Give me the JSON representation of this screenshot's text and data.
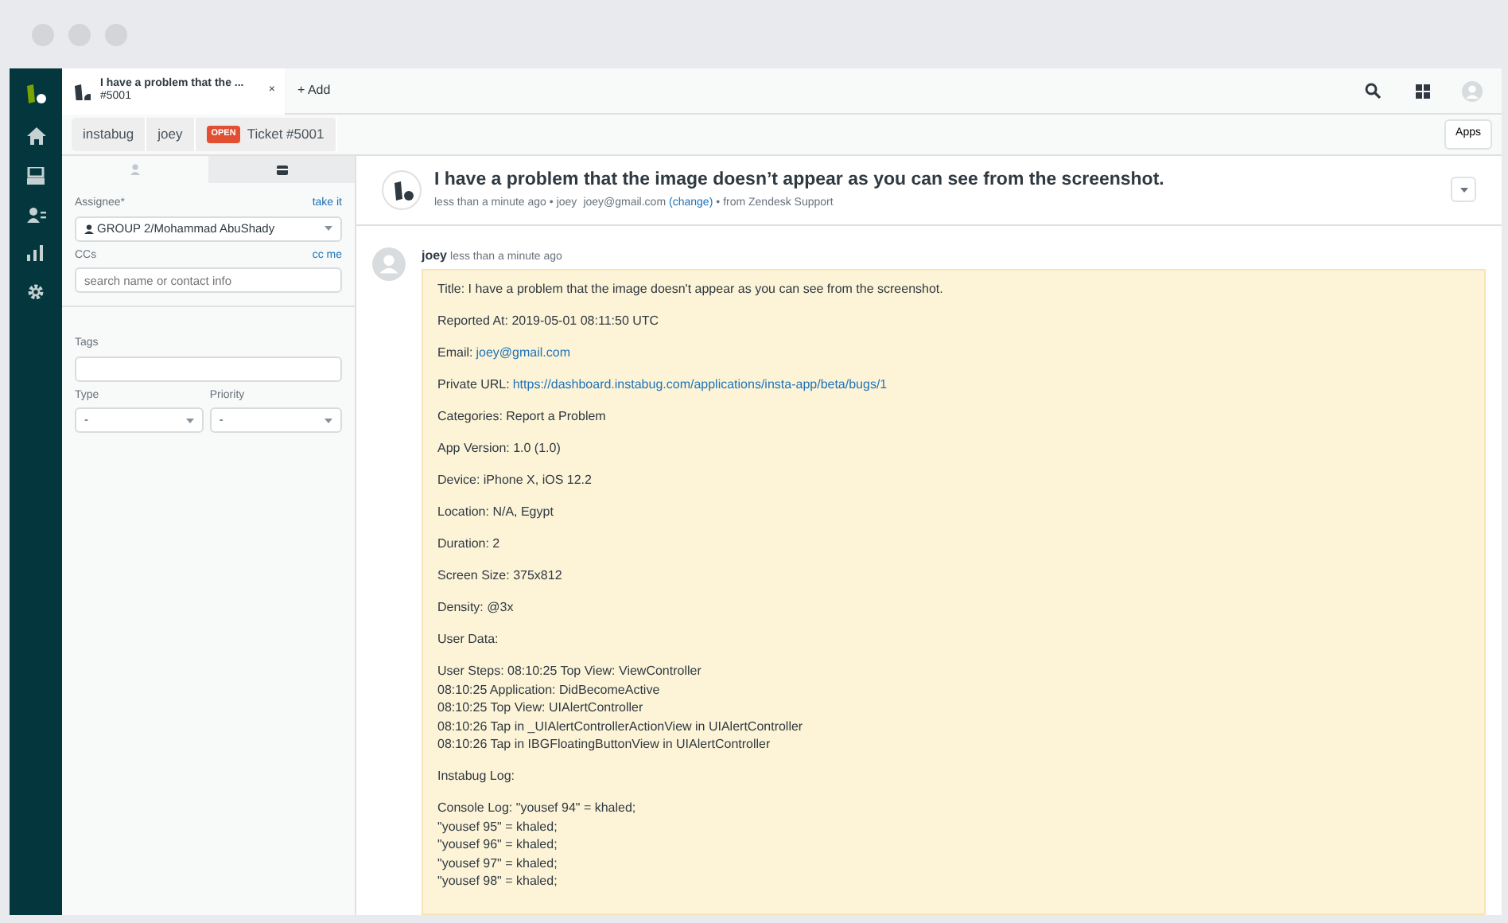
{
  "tab": {
    "title": "I have a problem that the ...",
    "subtitle": "#5001",
    "close": "×"
  },
  "add": "+ Add",
  "breadcrumbs": [
    {
      "kind": "crumb",
      "label": "instabug"
    },
    {
      "kind": "crumb",
      "label": "joey"
    },
    {
      "kind": "ticket",
      "badge": "OPEN",
      "label": "Ticket #5001"
    }
  ],
  "apps_button": "Apps",
  "side_tabs": [
    {
      "kind": "person",
      "selected": true
    },
    {
      "kind": "card",
      "selected": false
    }
  ],
  "assignee": {
    "label": "Assignee*",
    "action": "take it",
    "value": "GROUP 2/Mohammad AbuShady"
  },
  "ccs": {
    "label": "CCs",
    "action": "cc me",
    "placeholder": "search name or contact info"
  },
  "tags": {
    "label": "Tags"
  },
  "type": {
    "label": "Type",
    "value": "-"
  },
  "priority": {
    "label": "Priority",
    "value": "-"
  },
  "ticket": {
    "title": "I have a problem that the image doesn’t appear as you can see from the screenshot.",
    "meta_time": "less than a minute ago •",
    "meta_name": "joey",
    "meta_email": "joey@gmail.com",
    "meta_change": "(change)",
    "meta_source": "• from Zendesk Support"
  },
  "comment": {
    "author": "joey",
    "time": "less than a minute ago",
    "body": [
      {
        "kind": "text",
        "text": "Title: I have a problem that the image doesn't appear as you can see from the screenshot."
      },
      {
        "kind": "text",
        "text": "Reported At: 2019-05-01 08:11:50 UTC"
      },
      {
        "kind": "link",
        "label": "Email:",
        "link": "joey@gmail.com"
      },
      {
        "kind": "link",
        "label": "Private URL:",
        "link": "https://dashboard.instabug.com/applications/insta-app/beta/bugs/1"
      },
      {
        "kind": "text",
        "text": "Categories: Report a Problem"
      },
      {
        "kind": "text",
        "text": "App Version: 1.0 (1.0)"
      },
      {
        "kind": "text",
        "text": "Device: iPhone X, iOS 12.2"
      },
      {
        "kind": "text",
        "text": "Location: N/A, Egypt"
      },
      {
        "kind": "text",
        "text": "Duration: 2"
      },
      {
        "kind": "text",
        "text": "Screen Size: 375x812"
      },
      {
        "kind": "text",
        "text": "Density: @3x"
      },
      {
        "kind": "text",
        "text": "User Data:"
      },
      {
        "kind": "lines",
        "lines": [
          "User Steps: 08:10:25 Top View: ViewController",
          "08:10:25 Application: DidBecomeActive",
          "08:10:25 Top View: UIAlertController",
          "08:10:26 Tap in _UIAlertControllerActionView in UIAlertController",
          "08:10:26 Tap in IBGFloatingButtonView in UIAlertController"
        ]
      },
      {
        "kind": "text",
        "text": "Instabug Log:"
      },
      {
        "kind": "lines",
        "lines": [
          "Console Log: \"yousef 94\" = khaled;",
          "\"yousef 95\" = khaled;",
          "\"yousef 96\" = khaled;",
          "\"yousef 97\" = khaled;",
          "\"yousef 98\" = khaled;"
        ]
      }
    ]
  }
}
